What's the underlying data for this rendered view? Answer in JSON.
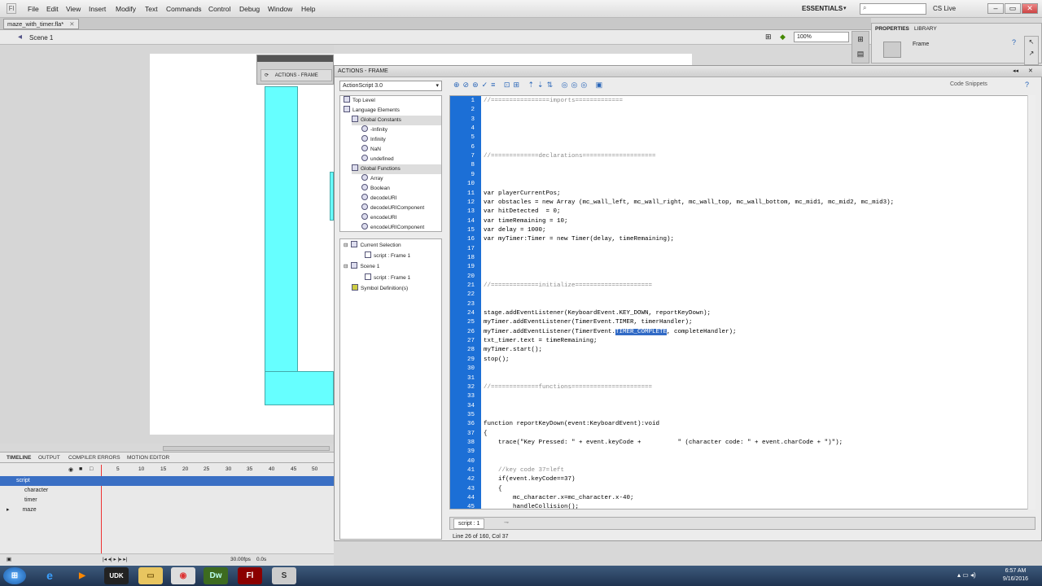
{
  "menubar": {
    "items": [
      "File",
      "Edit",
      "View",
      "Insert",
      "Modify",
      "Text",
      "Commands",
      "Control",
      "Debug",
      "Window",
      "Help"
    ],
    "workspace": "ESSENTIALS",
    "cs_live": "CS Live",
    "logo": "Fl"
  },
  "document": {
    "tab": "maze_with_timer.fla*",
    "scene": "Scene 1",
    "zoom": "100%"
  },
  "actions_docked": {
    "label": "ACTIONS - FRAME"
  },
  "timeline": {
    "tabs": [
      "TIMELINE",
      "OUTPUT",
      "COMPILER ERRORS",
      "MOTION EDITOR"
    ],
    "frame_numbers": [
      "5",
      "10",
      "15",
      "20",
      "25",
      "30",
      "35",
      "40",
      "45",
      "50"
    ],
    "layers": [
      "script",
      "character",
      "timer",
      "maze"
    ],
    "fps": "30.00fps",
    "time": "0.0s",
    "frame": "1"
  },
  "actions_panel": {
    "title": "ACTIONS - FRAME",
    "version": "ActionScript 3.0",
    "code_snippets": "Code Snippets",
    "tree_top": [
      {
        "label": "Top Level",
        "indent": 0
      },
      {
        "label": "Language Elements",
        "indent": 0
      },
      {
        "label": "Global Constants",
        "indent": 1
      },
      {
        "label": "-Infinity",
        "indent": 2
      },
      {
        "label": "Infinity",
        "indent": 2
      },
      {
        "label": "NaN",
        "indent": 2
      },
      {
        "label": "undefined",
        "indent": 2
      },
      {
        "label": "Global Functions",
        "indent": 1
      },
      {
        "label": "Array",
        "indent": 2
      },
      {
        "label": "Boolean",
        "indent": 2
      },
      {
        "label": "decodeURI",
        "indent": 2
      },
      {
        "label": "decodeURIComponent",
        "indent": 2
      },
      {
        "label": "encodeURI",
        "indent": 2
      },
      {
        "label": "encodeURIComponent",
        "indent": 2
      }
    ],
    "tree_bottom": [
      {
        "label": "Current Selection",
        "indent": 0
      },
      {
        "label": "script : Frame 1",
        "indent": 1
      },
      {
        "label": "Scene 1",
        "indent": 0
      },
      {
        "label": "script : Frame 1",
        "indent": 1
      },
      {
        "label": "Symbol Definition(s)",
        "indent": 0
      }
    ],
    "script_tab": "script : 1",
    "status": "Line 26 of 160, Col 37"
  },
  "code_lines": [
    {
      "n": "1",
      "t": "//================imports=============",
      "k": "comment"
    },
    {
      "n": "2",
      "t": "",
      "k": "code"
    },
    {
      "n": "3",
      "t": "",
      "k": "code"
    },
    {
      "n": "4",
      "t": "",
      "k": "code"
    },
    {
      "n": "5",
      "t": "",
      "k": "code"
    },
    {
      "n": "6",
      "t": "",
      "k": "code"
    },
    {
      "n": "7",
      "t": "//=============declarations====================",
      "k": "comment"
    },
    {
      "n": "8",
      "t": "",
      "k": "code"
    },
    {
      "n": "9",
      "t": "",
      "k": "code"
    },
    {
      "n": "10",
      "t": "",
      "k": "code"
    },
    {
      "n": "11",
      "t": "var playerCurrentPos;",
      "k": "code"
    },
    {
      "n": "12",
      "t": "var obstacles = new Array (mc_wall_left, mc_wall_right, mc_wall_top, mc_wall_bottom, mc_mid1, mc_mid2, mc_mid3);",
      "k": "code"
    },
    {
      "n": "13",
      "t": "var hitDetected  = 0;",
      "k": "code"
    },
    {
      "n": "14",
      "t": "var timeRemaining = 10;",
      "k": "code"
    },
    {
      "n": "15",
      "t": "var delay = 1000;",
      "k": "code"
    },
    {
      "n": "16",
      "t": "var myTimer:Timer = new Timer(delay, timeRemaining);",
      "k": "code"
    },
    {
      "n": "17",
      "t": "",
      "k": "code"
    },
    {
      "n": "18",
      "t": "",
      "k": "code"
    },
    {
      "n": "19",
      "t": "",
      "k": "code"
    },
    {
      "n": "20",
      "t": "",
      "k": "code"
    },
    {
      "n": "21",
      "t": "//=============initialize=====================",
      "k": "comment"
    },
    {
      "n": "22",
      "t": "",
      "k": "code"
    },
    {
      "n": "23",
      "t": "",
      "k": "code"
    },
    {
      "n": "24",
      "t": "stage.addEventListener(KeyboardEvent.KEY_DOWN, reportKeyDown);",
      "k": "code"
    },
    {
      "n": "25",
      "t": "myTimer.addEventListener(TimerEvent.TIMER, timerHandler);",
      "k": "code"
    },
    {
      "n": "26",
      "t": "myTimer.addEventListener(TimerEvent.TIMER_COMPLETE, completeHandler);",
      "k": "code"
    },
    {
      "n": "27",
      "t": "txt_timer.text = timeRemaining;",
      "k": "code"
    },
    {
      "n": "28",
      "t": "myTimer.start();",
      "k": "code"
    },
    {
      "n": "29",
      "t": "stop();",
      "k": "code"
    },
    {
      "n": "30",
      "t": "",
      "k": "code"
    },
    {
      "n": "31",
      "t": "",
      "k": "code"
    },
    {
      "n": "32",
      "t": "//=============functions======================",
      "k": "comment"
    },
    {
      "n": "33",
      "t": "",
      "k": "code"
    },
    {
      "n": "34",
      "t": "",
      "k": "code"
    },
    {
      "n": "35",
      "t": "",
      "k": "code"
    },
    {
      "n": "36",
      "t": "function reportKeyDown(event:KeyboardEvent):void",
      "k": "code"
    },
    {
      "n": "37",
      "t": "{",
      "k": "code"
    },
    {
      "n": "38",
      "t": "    trace(\"Key Pressed: \" + event.keyCode +          \" (character code: \" + event.charCode + \")\");",
      "k": "code"
    },
    {
      "n": "39",
      "t": "",
      "k": "code"
    },
    {
      "n": "40",
      "t": "",
      "k": "code"
    },
    {
      "n": "41",
      "t": "    //key code 37=left",
      "k": "comment"
    },
    {
      "n": "42",
      "t": "    if(event.keyCode==37)",
      "k": "code"
    },
    {
      "n": "43",
      "t": "    {",
      "k": "code"
    },
    {
      "n": "44",
      "t": "        mc_character.x=mc_character.x-40;",
      "k": "code"
    },
    {
      "n": "45",
      "t": "        handleCollision();",
      "k": "code"
    }
  ],
  "properties": {
    "tabs": [
      "PROPERTIES",
      "LIBRARY"
    ],
    "label": "Frame"
  },
  "taskbar": {
    "time": "6:57 AM",
    "date": "9/16/2016"
  },
  "colors": {
    "gutter": "#1c6fd6",
    "stage_shape": "#66ffff",
    "selection": "#316ac5"
  }
}
